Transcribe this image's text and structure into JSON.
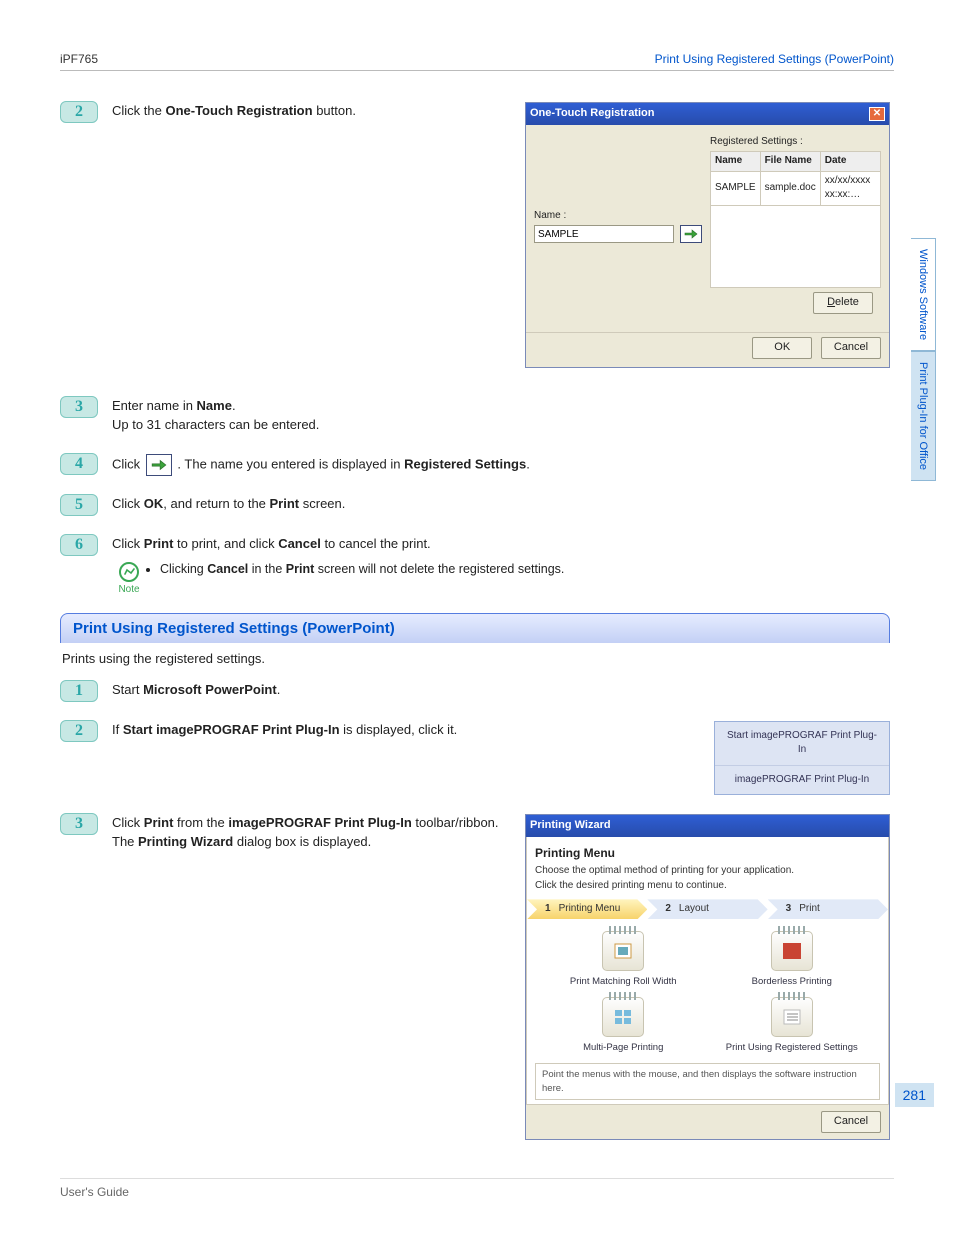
{
  "header": {
    "left": "iPF765",
    "right_link": "Print Using Registered Settings (PowerPoint)"
  },
  "footer": {
    "left": "User's Guide"
  },
  "page_number": "281",
  "side_tabs": {
    "t1": "Windows Software",
    "t2": "Print Plug-In for Office"
  },
  "stepsA": {
    "s2": {
      "num": "2",
      "pre": "Click the ",
      "b1": "One-Touch Registration",
      "post": " button."
    },
    "s3": {
      "num": "3",
      "l1a": "Enter name in ",
      "l1b": "Name",
      "l1c": ".",
      "l2": "Up to 31 characters can be entered."
    },
    "s4": {
      "num": "4",
      "pre": "Click ",
      "mid": ". The name you entered is displayed in ",
      "b": "Registered Settings",
      "post": "."
    },
    "s5": {
      "num": "5",
      "a": "Click ",
      "b1": "OK",
      "c": ", and return to the ",
      "b2": "Print",
      "d": " screen."
    },
    "s6": {
      "num": "6",
      "a": "Click ",
      "b1": "Print",
      "c": " to print, and click ",
      "b2": "Cancel",
      "d": " to cancel the print."
    },
    "note_label": "Note",
    "note_a": "Clicking ",
    "note_b1": "Cancel",
    "note_c": " in the ",
    "note_b2": "Print",
    "note_d": " screen will not delete the registered settings."
  },
  "section": {
    "title": "Print Using Registered Settings (PowerPoint)",
    "sub": "Prints using the registered settings."
  },
  "stepsB": {
    "s1": {
      "num": "1",
      "a": "Start ",
      "b": "Microsoft PowerPoint",
      "c": "."
    },
    "s2": {
      "num": "2",
      "a": "If ",
      "b": "Start imagePROGRAF Print Plug-In",
      "c": " is displayed, click it."
    },
    "s3": {
      "num": "3",
      "l1a": "Click ",
      "l1b": "Print",
      "l1c": " from the ",
      "l1d": "imagePROGRAF Print Plug-In",
      "l1e": " toolbar/ribbon.",
      "l2a": "The ",
      "l2b": "Printing Wizard",
      "l2c": " dialog box is displayed."
    }
  },
  "reg_dialog": {
    "title": "One-Touch Registration",
    "name_label": "Name :",
    "name_value": "SAMPLE",
    "list_header": "Registered Settings :",
    "cols": {
      "c1": "Name",
      "c2": "File Name",
      "c3": "Date"
    },
    "row": {
      "c1": "SAMPLE",
      "c2": "sample.doc",
      "c3": "xx/xx/xxxx xx:xx:…"
    },
    "btn_delete": "Delete",
    "btn_ok": "OK",
    "btn_cancel": "Cancel"
  },
  "toolbar_shot": {
    "row1": "Start imagePROGRAF Print Plug-In",
    "row2": "imagePROGRAF Print Plug-In"
  },
  "wizard": {
    "title": "Printing Wizard",
    "heading": "Printing Menu",
    "sub1": "Choose the optimal method of printing for your application.",
    "sub2": "Click the desired printing menu to continue.",
    "chev": {
      "n1": "1",
      "l1": "Printing Menu",
      "n2": "2",
      "l2": "Layout",
      "n3": "3",
      "l3": "Print"
    },
    "opts": {
      "o1": "Print Matching Roll Width",
      "o2": "Borderless Printing",
      "o3": "Multi-Page Printing",
      "o4": "Print Using Registered Settings"
    },
    "hint": "Point the menus with the mouse, and then displays the software instruction here.",
    "btn_cancel": "Cancel"
  }
}
